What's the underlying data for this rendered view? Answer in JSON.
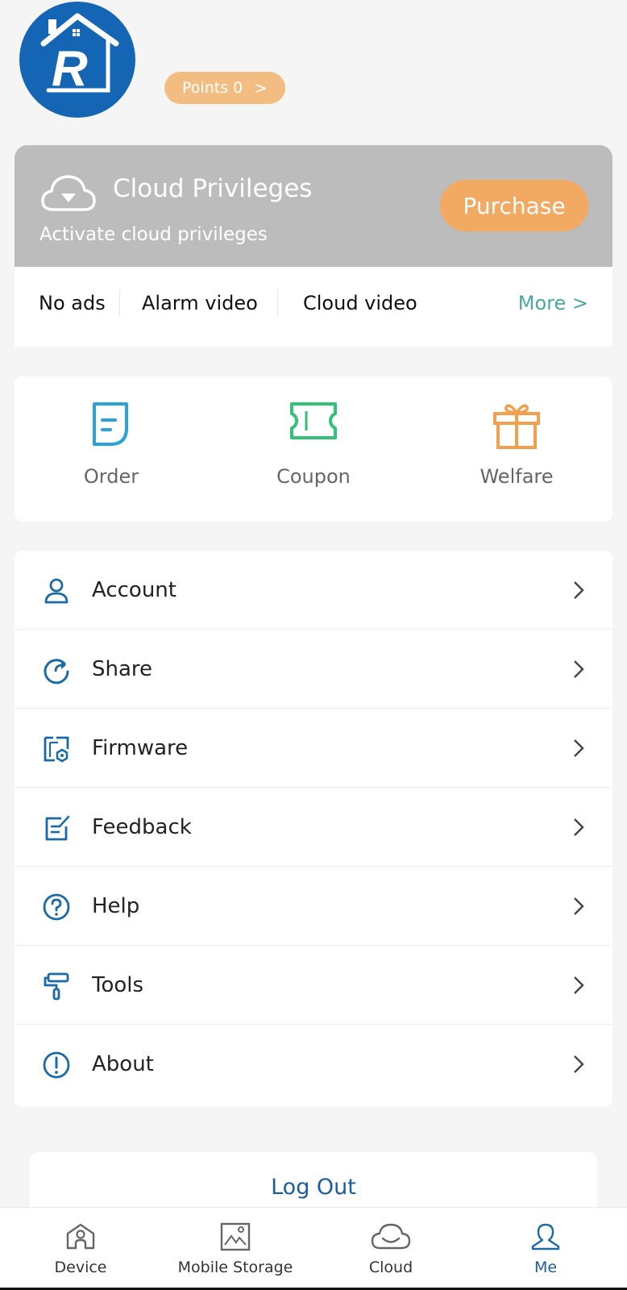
{
  "header": {
    "avatar_alt": "R house logo",
    "points_label": "Points 0",
    "points_chevron": ">"
  },
  "cloud": {
    "icon": "cloud-diamond-icon",
    "title": "Cloud Privileges",
    "subtitle": "Activate cloud privileges",
    "purchase_label": "Purchase",
    "perks": [
      "No ads",
      "Alarm video",
      "Cloud video"
    ],
    "more_label": "More >"
  },
  "quick": {
    "items": [
      {
        "label": "Order",
        "icon": "order-document-icon",
        "color": "#2aa3d8"
      },
      {
        "label": "Coupon",
        "icon": "coupon-ticket-icon",
        "color": "#35c07a"
      },
      {
        "label": "Welfare",
        "icon": "gift-icon",
        "color": "#f2a04e"
      }
    ]
  },
  "menu": {
    "items": [
      {
        "label": "Account",
        "icon": "user-icon"
      },
      {
        "label": "Share",
        "icon": "share-refresh-icon"
      },
      {
        "label": "Firmware",
        "icon": "firmware-icon"
      },
      {
        "label": "Feedback",
        "icon": "feedback-edit-icon"
      },
      {
        "label": "Help",
        "icon": "help-question-icon"
      },
      {
        "label": "Tools",
        "icon": "paint-roller-icon"
      },
      {
        "label": "About",
        "icon": "info-exclamation-icon"
      }
    ],
    "icon_color": "#1a6aa8"
  },
  "logout": {
    "label": "Log Out"
  },
  "tabbar": {
    "tabs": [
      {
        "label": "Device",
        "icon": "home-device-icon",
        "active": false
      },
      {
        "label": "Mobile Storage",
        "icon": "image-gallery-icon",
        "active": false
      },
      {
        "label": "Cloud",
        "icon": "cloud-icon",
        "active": false
      },
      {
        "label": "Me",
        "icon": "person-icon",
        "active": true
      }
    ]
  },
  "colors": {
    "accent_blue": "#1a5f9a",
    "orange": "#f2a961",
    "teal_more": "#4aa8a0"
  }
}
